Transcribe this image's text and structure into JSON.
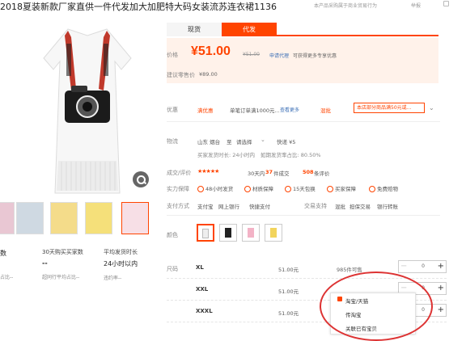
{
  "page": {
    "title": "2018夏装新款厂家直供一件代发加大加肥特大码女装流苏连衣裙1136",
    "top_note": "本产品采购属于商业贸易行为",
    "report": "举报"
  },
  "tabs": [
    "现货",
    "代发"
  ],
  "price": {
    "label": "价格",
    "value": "¥51.00",
    "old": "¥51.00",
    "apply_link": "申请代理",
    "apply_note": "可获得更多专享优惠",
    "suggest_label": "建议零售价",
    "suggest_value": "¥89.00"
  },
  "promo": {
    "label": "优惠",
    "tag": "满优惠",
    "text": "单笔订单满1000元...",
    "more": "查看更多",
    "mix_tag": "混批",
    "mix_text": "本店部分商品满50元或..."
  },
  "logistics": {
    "label": "物流",
    "from": "山东 烟台",
    "to_label": "至",
    "to_value": "请选择",
    "express": "快递 ¥5",
    "ship_line": "买家发货时长: 24小时内",
    "rate_line": "如期发货率占比: 80.50%"
  },
  "reviews": {
    "label": "成交/评价",
    "stars": "★★★★★",
    "deals_prefix": "30天内",
    "deals_count": "37",
    "deals_suffix": "件成交",
    "review_count": "508",
    "review_suffix": "条评价"
  },
  "guarantees": {
    "label": "实力保障",
    "items": [
      "48小时发货",
      "材质保障",
      "15天包换",
      "买家保障",
      "免费赔物"
    ]
  },
  "payment": {
    "label": "支付方式",
    "items": [
      "支付宝",
      "网上银行",
      "快捷支付"
    ],
    "trade_label": "交易支持",
    "trade_items": [
      "混批",
      "担保交易",
      "银行转账"
    ]
  },
  "color": {
    "label": "颜色"
  },
  "sizes": {
    "label": "尺码",
    "rows": [
      {
        "size": "XL",
        "price": "51.00元",
        "stock": "985件可售"
      },
      {
        "size": "XXL",
        "price": "51.00元",
        "stock": ""
      },
      {
        "size": "XXXL",
        "price": "51.00元",
        "stock": ""
      }
    ],
    "qty": "0"
  },
  "popup": {
    "items": [
      "淘宝/天猫",
      "传淘宝",
      "关联已有宝贝"
    ]
  },
  "stats": {
    "col1_value": "数",
    "col1_sub": "占比--",
    "col2_label": "30天购买买家数",
    "col2_value": "--",
    "col2_sub": "超同行平均占比--",
    "col3_label": "平均发货时长",
    "col3_value": "24小时以内",
    "col3_sub": "违约率--"
  },
  "colors": {
    "accent": "#ff4400",
    "price_bg": "#fff2ea",
    "link": "#3b6fb6"
  }
}
